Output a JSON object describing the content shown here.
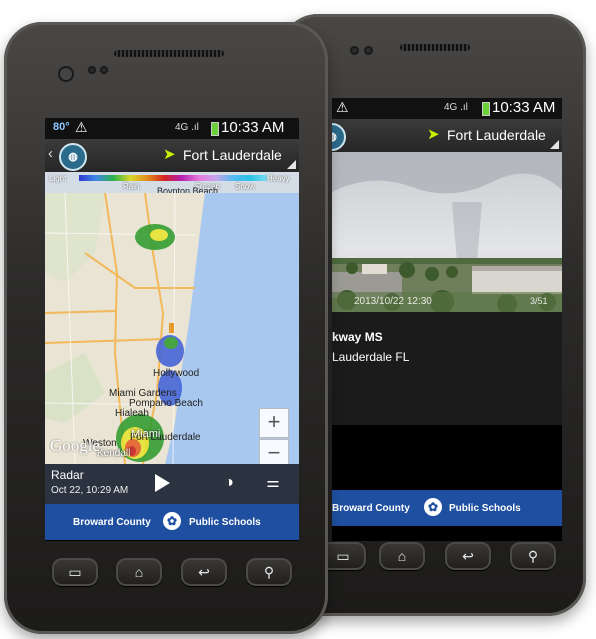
{
  "front_phone": {
    "status": {
      "temperature": "80°",
      "warning_glyph": "⚠",
      "signal_glyph": "4G .ıl",
      "time": "10:33 AM"
    },
    "appbar": {
      "back_glyph": "‹",
      "logo_glyph": "◍",
      "location_arrow_glyph": "➤",
      "location": "Fort Lauderdale"
    },
    "legend": {
      "light": "Light",
      "heavy": "Heavy",
      "rain": "Rain",
      "frozen": "Frozen",
      "snow": "Snow",
      "nearby_label": "Boynton Beach"
    },
    "map": {
      "places": [
        "Pompano Beach",
        "Fort Lauderdale",
        "Weston",
        "Hollywood",
        "Miami Gardens",
        "Hialeah",
        "Miami",
        "Kendall"
      ],
      "attribution": "Google",
      "zoom_in": "+",
      "zoom_out": "−"
    },
    "controls": {
      "label": "Radar",
      "timestamp": "Oct 22, 10:29 AM",
      "play_label": "",
      "brightness_glyph": "◑",
      "settings_glyph": "⚌"
    },
    "brand": {
      "left_text": "Broward County",
      "right_text": "Public Schools",
      "logo_glyph": "✿"
    },
    "nav": {
      "menu_glyph": "▭",
      "home_glyph": "⌂",
      "back_glyph": "↩",
      "search_glyph": "⚲"
    }
  },
  "back_phone": {
    "status": {
      "warning_glyph": "⚠",
      "signal_glyph": "4G .ıl",
      "time": "10:33 AM"
    },
    "appbar": {
      "location_arrow_glyph": "➤",
      "location": "Fort Lauderdale"
    },
    "camera": {
      "overlay_timestamp": "2013/10/22 12:30",
      "overlay_right": "3/51"
    },
    "info": {
      "school_name": "kway MS",
      "city": "Lauderdale FL"
    },
    "brand": {
      "left_text": "Broward County",
      "right_text": "Public Schools",
      "logo_glyph": "✿"
    },
    "nav": {
      "menu_glyph": "▭",
      "home_glyph": "⌂",
      "back_glyph": "↩",
      "search_glyph": "⚲"
    }
  },
  "colors": {
    "brand_blue": "#1f4fa0",
    "control_bar": "#2b3340",
    "water": "#a9c8f0",
    "land": "#e9e4d3",
    "location_accent": "#c8f000"
  }
}
